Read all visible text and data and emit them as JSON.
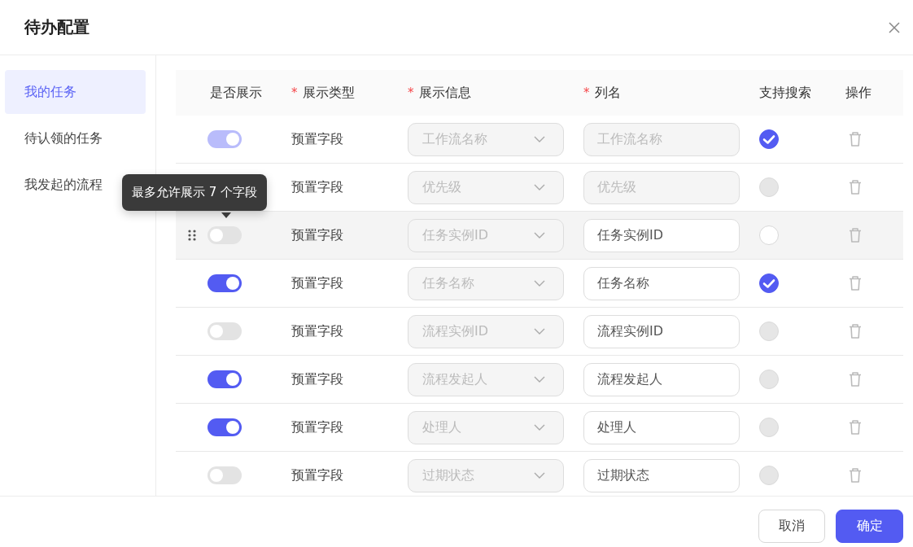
{
  "dialog": {
    "title": "待办配置"
  },
  "sidebar": {
    "items": [
      {
        "label": "我的任务",
        "selected": true
      },
      {
        "label": "待认领的任务",
        "selected": false
      },
      {
        "label": "我发起的流程",
        "selected": false
      }
    ]
  },
  "table": {
    "columns": [
      {
        "label": "是否展示"
      },
      {
        "label": "展示类型",
        "mark": "*"
      },
      {
        "label": "展示信息",
        "mark": "*"
      },
      {
        "label": "列名",
        "mark": "*"
      },
      {
        "label": "支持搜索"
      },
      {
        "label": "操作"
      }
    ],
    "rows": [
      {
        "shown": true,
        "toggle_disabled": true,
        "type": "预置字段",
        "info": "工作流名称",
        "column_name": "工作流名称",
        "name_disabled": true,
        "searchable": true,
        "hovered": false
      },
      {
        "type": "预置字段",
        "info": "优先级",
        "column_name": "优先级",
        "name_disabled": true,
        "searchable": false,
        "search_disabled": true,
        "hovered": false
      },
      {
        "shown": false,
        "type": "预置字段",
        "info": "任务实例ID",
        "column_name": "任务实例ID",
        "name_disabled": false,
        "searchable": false,
        "search_disabled": false,
        "hovered": true
      },
      {
        "shown": true,
        "type": "预置字段",
        "info": "任务名称",
        "column_name": "任务名称",
        "name_disabled": false,
        "searchable": true,
        "hovered": false
      },
      {
        "shown": false,
        "type": "预置字段",
        "info": "流程实例ID",
        "column_name": "流程实例ID",
        "name_disabled": false,
        "searchable": false,
        "search_disabled": true,
        "hovered": false
      },
      {
        "shown": true,
        "type": "预置字段",
        "info": "流程发起人",
        "column_name": "流程发起人",
        "name_disabled": false,
        "searchable": false,
        "search_disabled": true,
        "hovered": false
      },
      {
        "shown": true,
        "type": "预置字段",
        "info": "处理人",
        "column_name": "处理人",
        "name_disabled": false,
        "searchable": false,
        "search_disabled": true,
        "hovered": false
      },
      {
        "shown": false,
        "type": "预置字段",
        "info": "过期状态",
        "column_name": "过期状态",
        "name_disabled": false,
        "searchable": false,
        "search_disabled": true,
        "hovered": false
      }
    ]
  },
  "tooltip": {
    "text": "最多允许展示 7 个字段"
  },
  "footer": {
    "buttons": [
      {
        "label": "取消",
        "kind": "secondary"
      },
      {
        "label": "确定",
        "kind": "primary"
      }
    ]
  }
}
